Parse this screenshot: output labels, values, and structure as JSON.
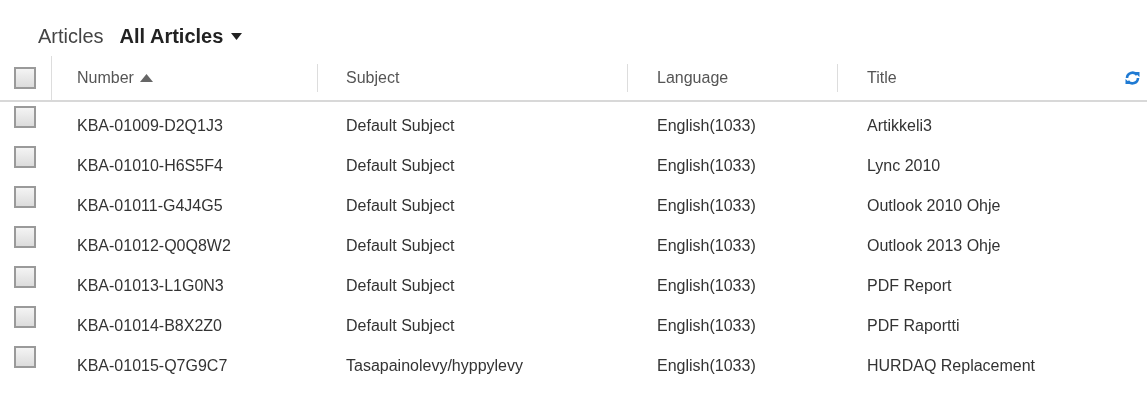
{
  "header": {
    "title": "Articles",
    "view": "All Articles"
  },
  "table": {
    "select_all": {
      "checked": false
    },
    "columns": [
      {
        "label": "Number",
        "sorted": true
      },
      {
        "label": "Subject",
        "sorted": false
      },
      {
        "label": "Language",
        "sorted": false
      },
      {
        "label": "Title",
        "sorted": false
      }
    ],
    "rows": [
      {
        "checked": false,
        "cells": [
          "KBA-01009-D2Q1J3",
          "Default Subject",
          "English(1033)",
          "Artikkeli3"
        ]
      },
      {
        "checked": false,
        "cells": [
          "KBA-01010-H6S5F4",
          "Default Subject",
          "English(1033)",
          "Lync 2010"
        ]
      },
      {
        "checked": false,
        "cells": [
          "KBA-01011-G4J4G5",
          "Default Subject",
          "English(1033)",
          "Outlook 2010 Ohje"
        ]
      },
      {
        "checked": false,
        "cells": [
          "KBA-01012-Q0Q8W2",
          "Default Subject",
          "English(1033)",
          "Outlook 2013 Ohje"
        ]
      },
      {
        "checked": false,
        "cells": [
          "KBA-01013-L1G0N3",
          "Default Subject",
          "English(1033)",
          "PDF Report"
        ]
      },
      {
        "checked": false,
        "cells": [
          "KBA-01014-B8X2Z0",
          "Default Subject",
          "English(1033)",
          "PDF Raportti"
        ]
      },
      {
        "checked": false,
        "cells": [
          "KBA-01015-Q7G9C7",
          "Tasapainolevy/hyppylevy",
          "English(1033)",
          "HURDAQ Replacement"
        ]
      }
    ]
  }
}
